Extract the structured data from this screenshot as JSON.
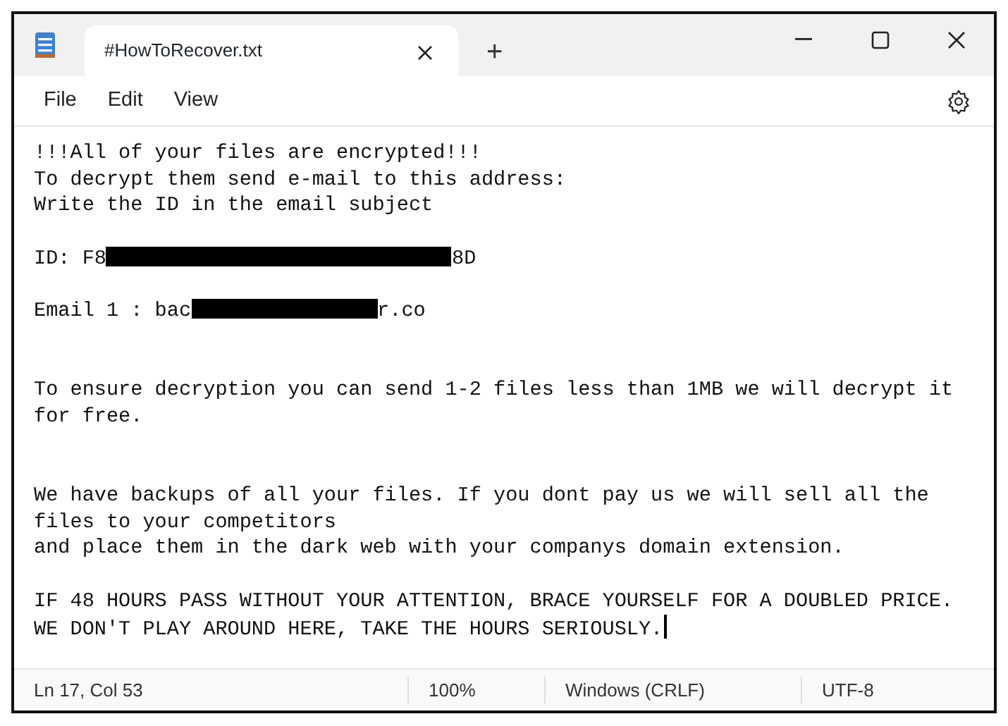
{
  "window": {
    "tab_title": "#HowToRecover.txt",
    "new_tab": "+"
  },
  "menu": [
    "File",
    "Edit",
    "View"
  ],
  "lines": [
    {
      "kind": "text",
      "text": "!!!All of your files are encrypted!!!"
    },
    {
      "kind": "text",
      "text": "To decrypt them send e-mail to this address:"
    },
    {
      "kind": "text",
      "text": "Write the ID in the email subject"
    },
    {
      "kind": "blank"
    },
    {
      "kind": "redacted",
      "before": "ID: F8",
      "after": "8D"
    },
    {
      "kind": "blank"
    },
    {
      "kind": "redacted",
      "before": "Email 1 : bac",
      "after": "r.co"
    },
    {
      "kind": "blank"
    },
    {
      "kind": "blank"
    },
    {
      "kind": "text",
      "text": "To ensure decryption you can send 1-2 files less than 1MB we will decrypt it"
    },
    {
      "kind": "text",
      "text": "for free."
    },
    {
      "kind": "blank"
    },
    {
      "kind": "blank"
    },
    {
      "kind": "text",
      "text": "We have backups of all your files. If you dont pay us we will sell all the"
    },
    {
      "kind": "text",
      "text": "files to your competitors"
    },
    {
      "kind": "text",
      "text": "and place them in the dark web with your companys domain extension."
    },
    {
      "kind": "blank"
    },
    {
      "kind": "text",
      "text": "IF 48 HOURS PASS WITHOUT YOUR ATTENTION, BRACE YOURSELF FOR A DOUBLED PRICE."
    },
    {
      "kind": "text",
      "text": "WE DON'T PLAY AROUND HERE, TAKE THE HOURS SERIOUSLY.",
      "cursor": true
    }
  ],
  "status_bar": [
    "Ln 17, Col 53",
    "100%",
    "Windows (CRLF)",
    "UTF-8"
  ]
}
